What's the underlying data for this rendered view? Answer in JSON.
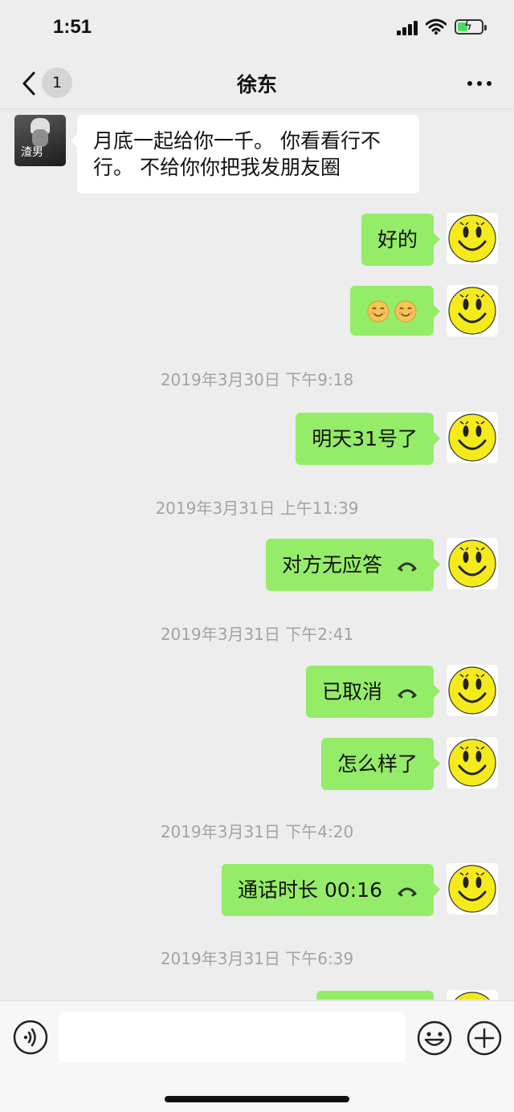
{
  "status_bar": {
    "time": "1:51"
  },
  "nav": {
    "unread_count": "1",
    "title": "徐东"
  },
  "contact_avatar_label": "渣男",
  "messages": [
    {
      "text": "月底一起给你一千。 你看看行不行。 不给你你把我发朋友圈"
    },
    {
      "text": "好的"
    },
    {
      "emoji": "😊😊"
    },
    {
      "timestamp": "2019年3月30日 下午9:18"
    },
    {
      "text": "明天31号了"
    },
    {
      "timestamp": "2019年3月31日 上午11:39"
    },
    {
      "text": "对方无应答"
    },
    {
      "timestamp": "2019年3月31日 下午2:41"
    },
    {
      "text": "已取消"
    },
    {
      "text": "怎么样了"
    },
    {
      "timestamp": "2019年3月31日 下午4:20"
    },
    {
      "text": "通话时长 00:16"
    },
    {
      "timestamp": "2019年3月31日 下午6:39"
    }
  ],
  "input": {
    "placeholder": ""
  },
  "colors": {
    "outgoing_bubble": "#95ec69",
    "incoming_bubble": "#ffffff",
    "background": "#ededed"
  }
}
